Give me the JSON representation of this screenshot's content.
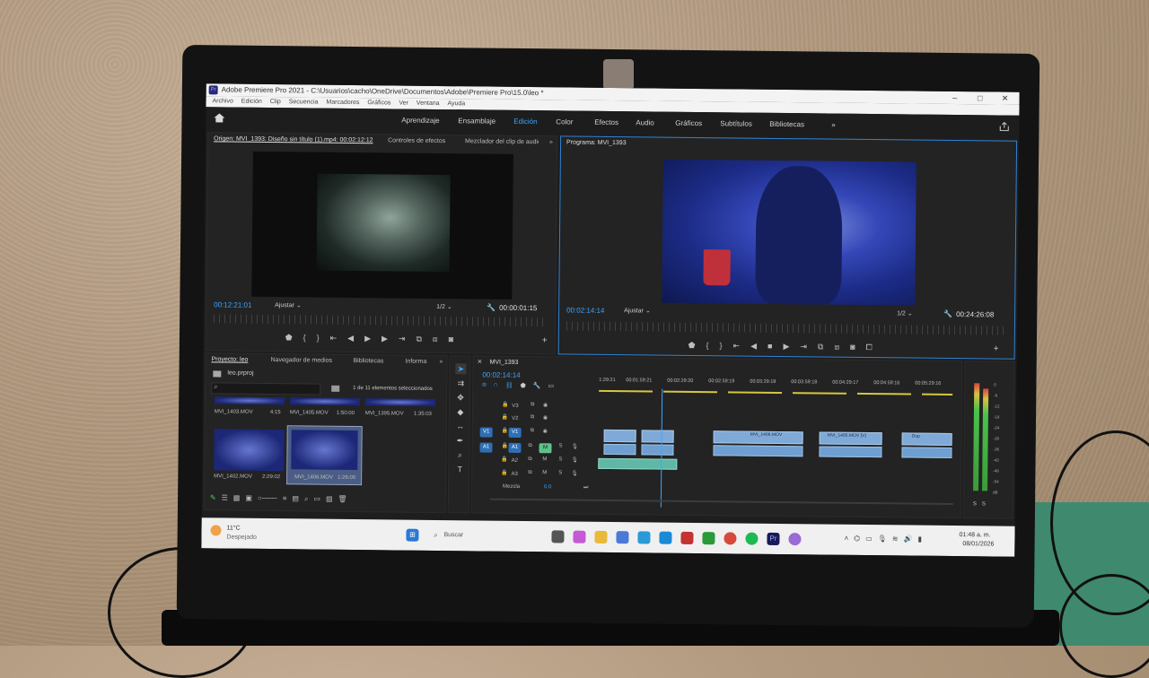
{
  "window": {
    "title": "Adobe Premiere Pro 2021 - C:\\Usuarios\\cacho\\OneDrive\\Documentos\\Adobe\\Premiere Pro\\15.0\\leo *",
    "min": "–",
    "max": "□",
    "close": "✕"
  },
  "menu": [
    "Archivo",
    "Edición",
    "Clip",
    "Secuencia",
    "Marcadores",
    "Gráficos",
    "Ver",
    "Ventana",
    "Ayuda"
  ],
  "workspaces": [
    "Aprendizaje",
    "Ensamblaje",
    "Edición",
    "Color",
    "Efectos",
    "Audio",
    "Gráficos",
    "Subtítulos",
    "Bibliotecas"
  ],
  "workspace_more": "»",
  "source": {
    "tab_label": "Origen: MVI_1393: Diseño sin título (1).mp4: 00:02:12:12",
    "tab2": "Controles de efectos",
    "tab3": "Mezclador del clip de audio",
    "more": "»",
    "timecode": "00:12:21:01",
    "fit": "Ajustar",
    "resolution": "1/2",
    "duration": "00:00:01:15"
  },
  "program": {
    "tab_label": "Programa: MVI_1393",
    "timecode": "00:02:14:14",
    "fit": "Ajustar",
    "resolution": "1/2",
    "duration": "00:24:26:08"
  },
  "project": {
    "tab_label": "Proyecto: leo",
    "tab2": "Navegador de medios",
    "tab3": "Bibliotecas",
    "tab4": "Informa",
    "more": "»",
    "file": "leo.prproj",
    "selection": "1 de 11 elementos seleccionados",
    "row1": [
      {
        "name": "MVI_1403.MOV",
        "dur": "4:15"
      },
      {
        "name": "MVI_1405.MOV",
        "dur": "1:50:00"
      },
      {
        "name": "MVI_1395.MOV",
        "dur": "1:35:03"
      }
    ],
    "row2": [
      {
        "name": "MVI_1402.MOV",
        "dur": "2:29:02"
      },
      {
        "name": "MVI_1406.MOV",
        "dur": "1:26:00"
      }
    ]
  },
  "timeline": {
    "tab_label": "MVI_1393",
    "timecode": "00:02:14:14",
    "ruler": [
      "1:29:21",
      "00:01:59:21",
      "00:02:29:20",
      "00:02:59:19",
      "00:03:29:18",
      "00:03:59:18",
      "00:04:29:17",
      "00:04:59:16",
      "00:05:29:16"
    ],
    "tracks": [
      {
        "id": "V3",
        "src": ""
      },
      {
        "id": "V2",
        "src": ""
      },
      {
        "id": "V1",
        "src": "V1"
      },
      {
        "id": "A1",
        "src": "A1"
      },
      {
        "id": "A2",
        "src": ""
      },
      {
        "id": "A3",
        "src": ""
      }
    ],
    "mix_label": "Mezcla",
    "mix_value": "0.0",
    "clip_labels": [
      "MVI_1406.MOV",
      "MVI_1405.MOV [V]",
      "Dup"
    ],
    "meter_scale": [
      "0",
      "-6",
      "-12",
      "-18",
      "-24",
      "-30",
      "-36",
      "-42",
      "-48",
      "-54",
      "dB"
    ],
    "solo": "S"
  },
  "taskbar": {
    "weather_temp": "11°C",
    "weather_desc": "Despejado",
    "search": "Buscar",
    "time": "01:48 a. m.",
    "date": "08/01/2026"
  }
}
